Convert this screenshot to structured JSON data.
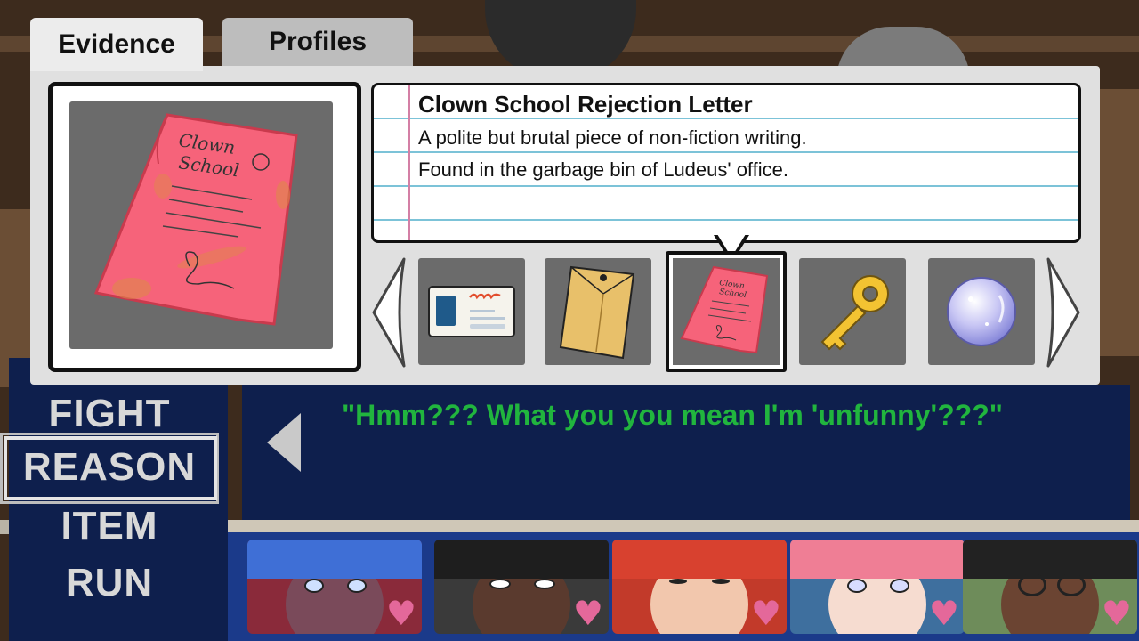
{
  "tabs": {
    "evidence_label": "Evidence",
    "profiles_label": "Profiles"
  },
  "selected_evidence": {
    "title": "Clown School Rejection Letter",
    "description_line1": "A polite but brutal piece of non-fiction writing.",
    "description_line2": "Found in the garbage bin of Ludeus' office.",
    "image_text": [
      "Clown",
      "School"
    ]
  },
  "evidence_items": [
    {
      "icon": "id-card-icon"
    },
    {
      "icon": "envelope-icon"
    },
    {
      "icon": "rejection-letter-icon",
      "selected": true
    },
    {
      "icon": "gold-key-icon"
    },
    {
      "icon": "crystal-orb-icon"
    }
  ],
  "battle_menu": {
    "fight": "FIGHT",
    "reason": "REASON",
    "item": "ITEM",
    "run": "RUN",
    "selected": "REASON"
  },
  "dialogue": {
    "text": "\"Hmm??? What you you mean I'm 'unfunny'???\""
  },
  "party": [
    {
      "name_icon": "blue-hair-character-portrait",
      "hair": "#3f6fd6",
      "skin": "#7a4a5a",
      "bg": "#8a2a3a"
    },
    {
      "name_icon": "dark-hair-character-portrait",
      "hair": "#1e1e1e",
      "skin": "#5a3a2e",
      "bg": "#3a3a3a"
    },
    {
      "name_icon": "red-hair-character-portrait",
      "hair": "#d8412f",
      "skin": "#f2c7ad",
      "bg": "#c23a2a"
    },
    {
      "name_icon": "pink-hair-character-portrait",
      "hair": "#ef7e95",
      "skin": "#f6dcd0",
      "bg": "#3e6f9e"
    },
    {
      "name_icon": "glasses-character-portrait",
      "hair": "#222222",
      "skin": "#6b4432",
      "bg": "#6e8c5a"
    }
  ],
  "colors": {
    "dialogue_text": "#21b53e",
    "menu_bg": "#0e1f4d",
    "party_bar": "#1b3a8a",
    "heart": "#e4689a"
  }
}
